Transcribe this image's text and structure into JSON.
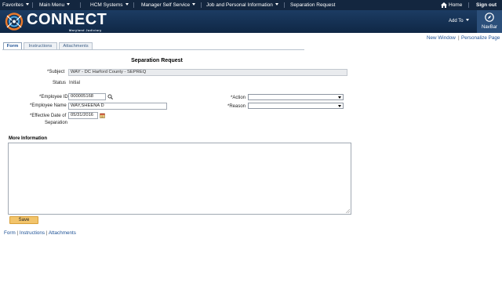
{
  "topnav": {
    "favorites": "Favorites",
    "main_menu": "Main Menu",
    "hcm_systems": "HCM Systems",
    "manager_self_service": "Manager Self Service",
    "job_personal_info": "Job and Personal Information",
    "separation_request": "Separation Request",
    "home": "Home",
    "sign_out": "Sign out"
  },
  "banner": {
    "brand": "CONNECT",
    "brand_sub": "Maryland Judiciary",
    "add_to": "Add To",
    "navbar": "NavBar"
  },
  "page_links": {
    "new_window": "New Window",
    "separator": "|",
    "personalize_page": "Personalize Page"
  },
  "tabs": {
    "form": "Form",
    "instructions": "Instructions",
    "attachments": "Attachments"
  },
  "form": {
    "title": "Separation Request",
    "subject_label": "*Subject",
    "subject_value": "WAY - DC Harford County - SEPREQ",
    "status_label": "Status",
    "status_value": "Initial",
    "employee_id_label": "*Employee ID",
    "employee_id_value": "000005168",
    "employee_name_label": "*Employee Name",
    "employee_name_value": "WAY,SHEENA D",
    "eff_date_label_1": "*Effective Date of",
    "eff_date_label_2": "Separation",
    "eff_date_value": "05/31/2016",
    "action_label": "*Action",
    "reason_label": "*Reason",
    "more_info_label": "More Information",
    "save_label": "Save"
  },
  "footer": {
    "form": "Form",
    "instructions": "Instructions",
    "attachments": "Attachments",
    "separator": "|"
  },
  "colors": {
    "topnav_bg": "#13263f",
    "banner_bg": "#1c3c63",
    "link": "#1a4f94",
    "save_button": "#f2c46b"
  }
}
